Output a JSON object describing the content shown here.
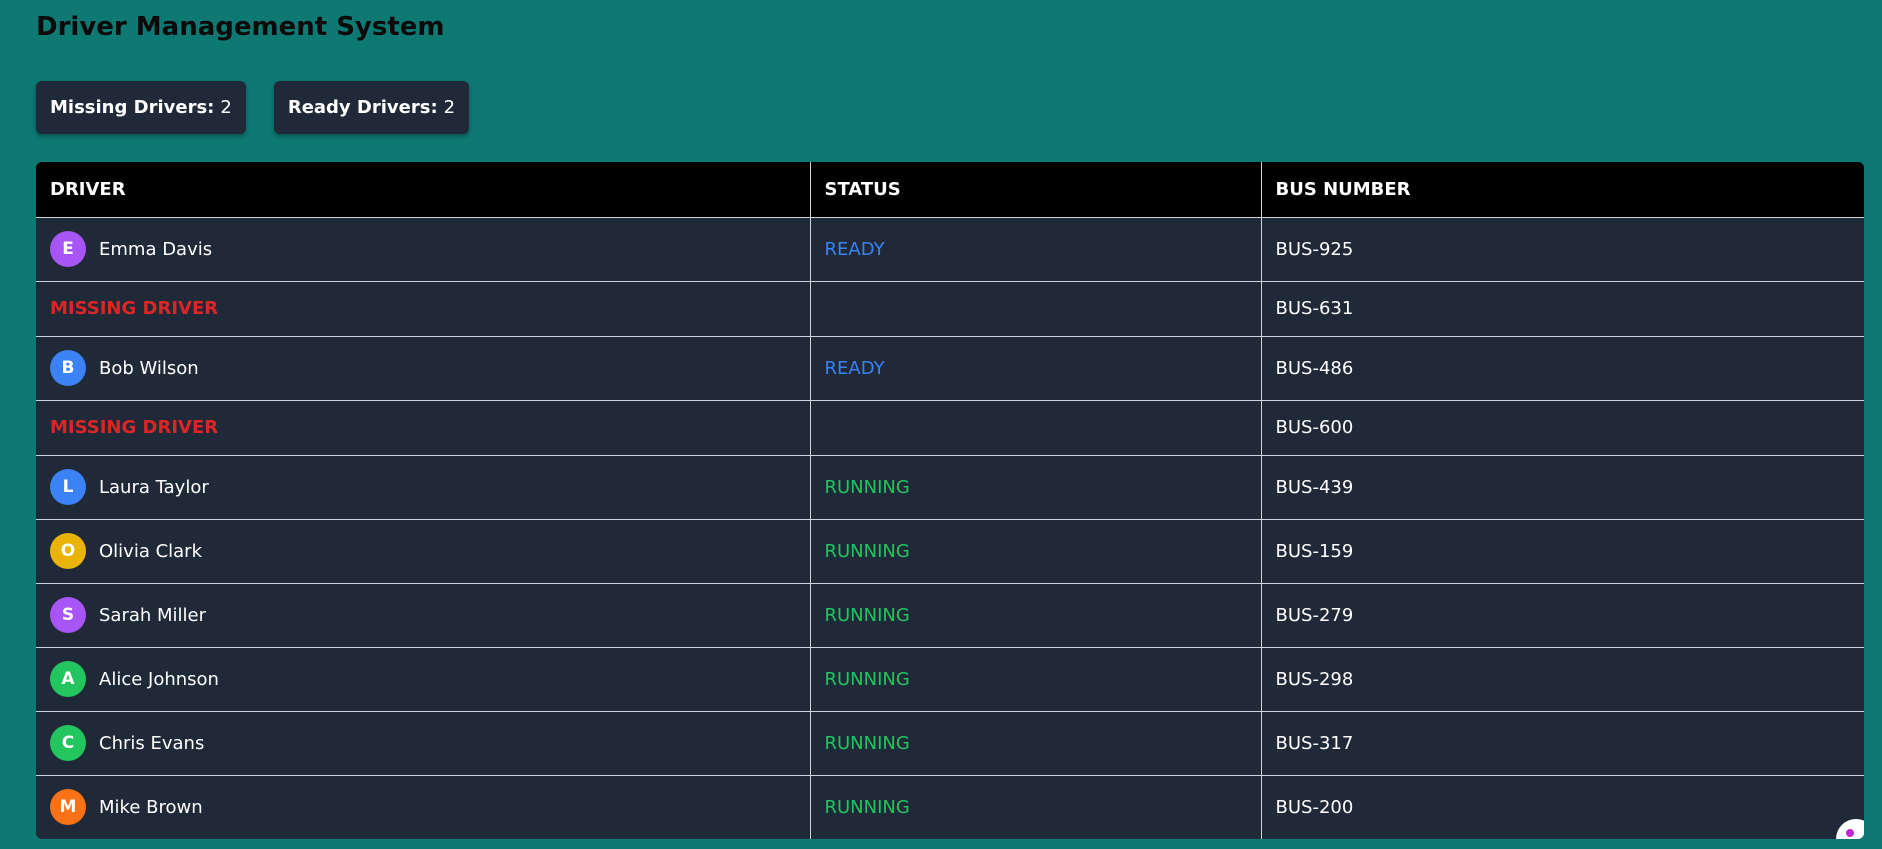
{
  "page": {
    "title": "Driver Management System"
  },
  "summary": {
    "missing": {
      "label": "Missing Drivers:",
      "value": "2"
    },
    "ready": {
      "label": "Ready Drivers:",
      "value": "2"
    }
  },
  "table": {
    "headers": {
      "driver": "DRIVER",
      "status": "STATUS",
      "bus": "BUS NUMBER"
    },
    "rows": [
      {
        "missing": false,
        "initial": "E",
        "name": "Emma Davis",
        "status": "READY",
        "bus": "BUS-925",
        "avatar_color": "#a855f7",
        "status_color": "#3b82f6"
      },
      {
        "missing": true,
        "missing_label": "MISSING DRIVER",
        "status": "",
        "bus": "BUS-631"
      },
      {
        "missing": false,
        "initial": "B",
        "name": "Bob Wilson",
        "status": "READY",
        "bus": "BUS-486",
        "avatar_color": "#3b82f6",
        "status_color": "#3b82f6"
      },
      {
        "missing": true,
        "missing_label": "MISSING DRIVER",
        "status": "",
        "bus": "BUS-600"
      },
      {
        "missing": false,
        "initial": "L",
        "name": "Laura Taylor",
        "status": "RUNNING",
        "bus": "BUS-439",
        "avatar_color": "#3b82f6",
        "status_color": "#22c55e"
      },
      {
        "missing": false,
        "initial": "O",
        "name": "Olivia Clark",
        "status": "RUNNING",
        "bus": "BUS-159",
        "avatar_color": "#eab308",
        "status_color": "#22c55e"
      },
      {
        "missing": false,
        "initial": "S",
        "name": "Sarah Miller",
        "status": "RUNNING",
        "bus": "BUS-279",
        "avatar_color": "#a855f7",
        "status_color": "#22c55e"
      },
      {
        "missing": false,
        "initial": "A",
        "name": "Alice Johnson",
        "status": "RUNNING",
        "bus": "BUS-298",
        "avatar_color": "#22c55e",
        "status_color": "#22c55e"
      },
      {
        "missing": false,
        "initial": "C",
        "name": "Chris Evans",
        "status": "RUNNING",
        "bus": "BUS-317",
        "avatar_color": "#22c55e",
        "status_color": "#22c55e"
      },
      {
        "missing": false,
        "initial": "M",
        "name": "Mike Brown",
        "status": "RUNNING",
        "bus": "BUS-200",
        "avatar_color": "#f97316",
        "status_color": "#22c55e"
      }
    ]
  }
}
